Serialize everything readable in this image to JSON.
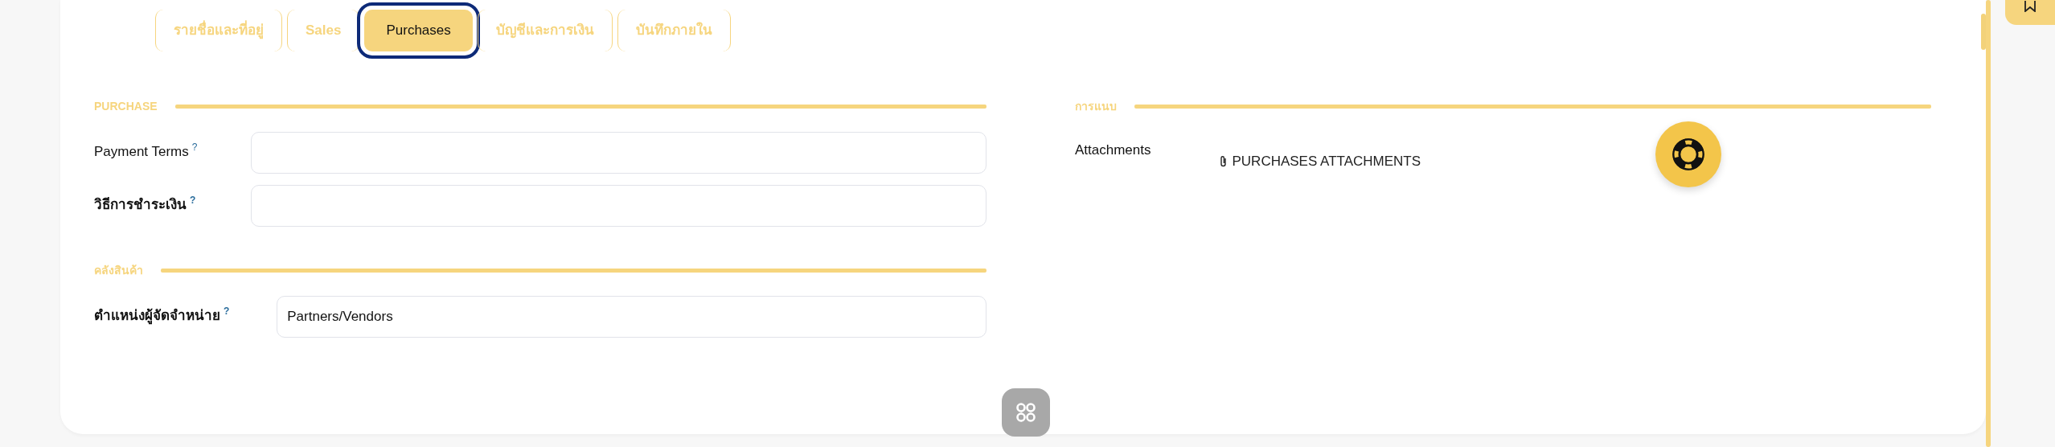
{
  "tabs": [
    {
      "label": "รายชื่อและที่อยู่",
      "selected": false,
      "focused": false
    },
    {
      "label": "Sales",
      "selected": false,
      "focused": false
    },
    {
      "label": "Purchases",
      "selected": true,
      "focused": true
    },
    {
      "label": "บัญชีและการเงิน",
      "selected": false,
      "focused": false
    },
    {
      "label": "บันทึกภายใน",
      "selected": false,
      "focused": false
    }
  ],
  "left_sections": [
    {
      "title": "PURCHASE",
      "fields": [
        {
          "label": "Payment Terms",
          "help": "?"
        },
        {
          "label": "วิธีการชำระเงิน",
          "help": "?"
        }
      ]
    },
    {
      "title": "คลังสินค้า",
      "fields": [
        {
          "label": "ตำแหน่งผู้จัดจำหน่าย",
          "help": "?",
          "value": "Partners/Vendors"
        }
      ]
    }
  ],
  "right_section": {
    "title": "การแนบ",
    "label": "Attachments",
    "link": "PURCHASES ATTACHMENTS"
  }
}
